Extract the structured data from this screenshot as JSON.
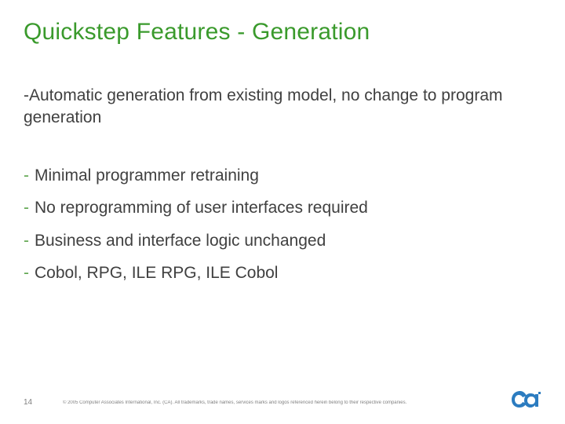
{
  "title": "Quickstep Features - Generation",
  "lead": {
    "text": "Automatic generation from existing model, no change to program generation"
  },
  "bullets": [
    {
      "text": "Minimal programmer retraining"
    },
    {
      "text": "No reprogramming of user interfaces required"
    },
    {
      "text": "Business and interface logic unchanged"
    },
    {
      "text": "Cobol, RPG, ILE RPG, ILE Cobol"
    }
  ],
  "footer": {
    "page_number": "14",
    "copyright": "© 2005 Computer Associates International, Inc. (CA). All trademarks, trade names, services marks and logos referenced herein belong to their respective companies."
  },
  "logo_name": "ca-logo"
}
